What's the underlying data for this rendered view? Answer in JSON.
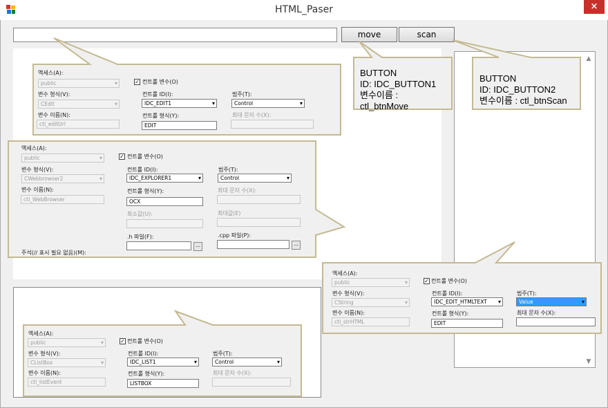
{
  "window": {
    "title": "HTML_Paser",
    "close_label": "×"
  },
  "toolbar": {
    "url_value": "",
    "move_label": "move",
    "scan_label": "scan"
  },
  "labels": {
    "access": "액세스(A):",
    "control_var": "컨트롤 변수(O)",
    "var_type": "변수 형식(V):",
    "control_id": "컨트롤 ID(I):",
    "category": "범주(T):",
    "var_name": "변수 이름(N):",
    "control_type": "컨트롤 형식(Y):",
    "max_chars": "최대 문자 수(X):",
    "min_value": "최소값(U):",
    "max_value": "최대값(E)",
    "h_file": ".h 파일(F):",
    "cpp_file": ".cpp 파일(P):",
    "comment": "주석(// 표시 필요 없음)(M):",
    "access_value": "public",
    "browse": "..."
  },
  "dialogs": {
    "edit": {
      "var_type": "CEdit",
      "control_id": "IDC_EDIT1",
      "category": "Control",
      "var_name": "ctl_editUrl",
      "control_type": "EDIT"
    },
    "web": {
      "var_type": "CWebbrowser2",
      "control_id": "IDC_EXPLORER1",
      "category": "Control",
      "var_name": "ctl_WebBrowser",
      "control_type": "OCX"
    },
    "html": {
      "var_type": "CString",
      "control_id": "IDC_EDIT_HTMLTEXT",
      "category": "Value",
      "var_name": "ctl_strHTML",
      "control_type": "EDIT"
    },
    "list": {
      "var_type": "CListBox",
      "control_id": "IDC_LIST1",
      "category": "Control",
      "var_name": "ctl_listEvent",
      "control_type": "LISTBOX"
    }
  },
  "notes": {
    "move": {
      "l1": "BUTTON",
      "l2": "ID: IDC_BUTTON1",
      "l3": "변수이름 :",
      "l4": "ctl_btnMove"
    },
    "scan": {
      "l1": "BUTTON",
      "l2": "ID: IDC_BUTTON2",
      "l3": "변수이름 : ctl_btnScan"
    }
  },
  "colors": {
    "callout_border": "#c3b991",
    "selection": "#3399ff",
    "close": "#c7302a"
  }
}
